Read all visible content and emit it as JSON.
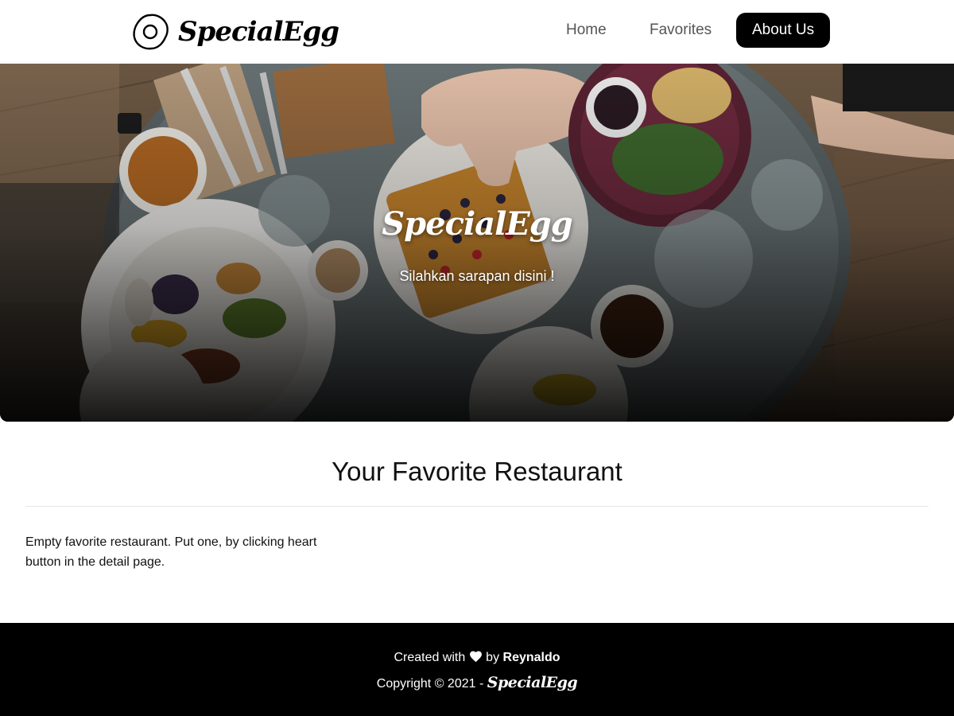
{
  "header": {
    "brand_name": "SpecialEgg",
    "logo_icon": "fried-egg-icon",
    "nav": {
      "home": "Home",
      "favorites": "Favorites",
      "about": "About Us"
    },
    "active_nav": "about"
  },
  "hero": {
    "title": "SpecialEgg",
    "subtitle": "Silahkan sarapan disini !"
  },
  "main": {
    "heading": "Your Favorite Restaurant",
    "empty_message": "Empty favorite restaurant. Put one, by clicking heart button in the detail page."
  },
  "footer": {
    "created_prefix": "Created with",
    "heart_icon": "heart-icon",
    "by_text": "by",
    "author": "Reynaldo",
    "copyright": "Copyright © 2021 -",
    "brand_name": "SpecialEgg"
  },
  "colors": {
    "primary": "#000000",
    "background": "#ffffff",
    "nav_text": "#555555"
  }
}
